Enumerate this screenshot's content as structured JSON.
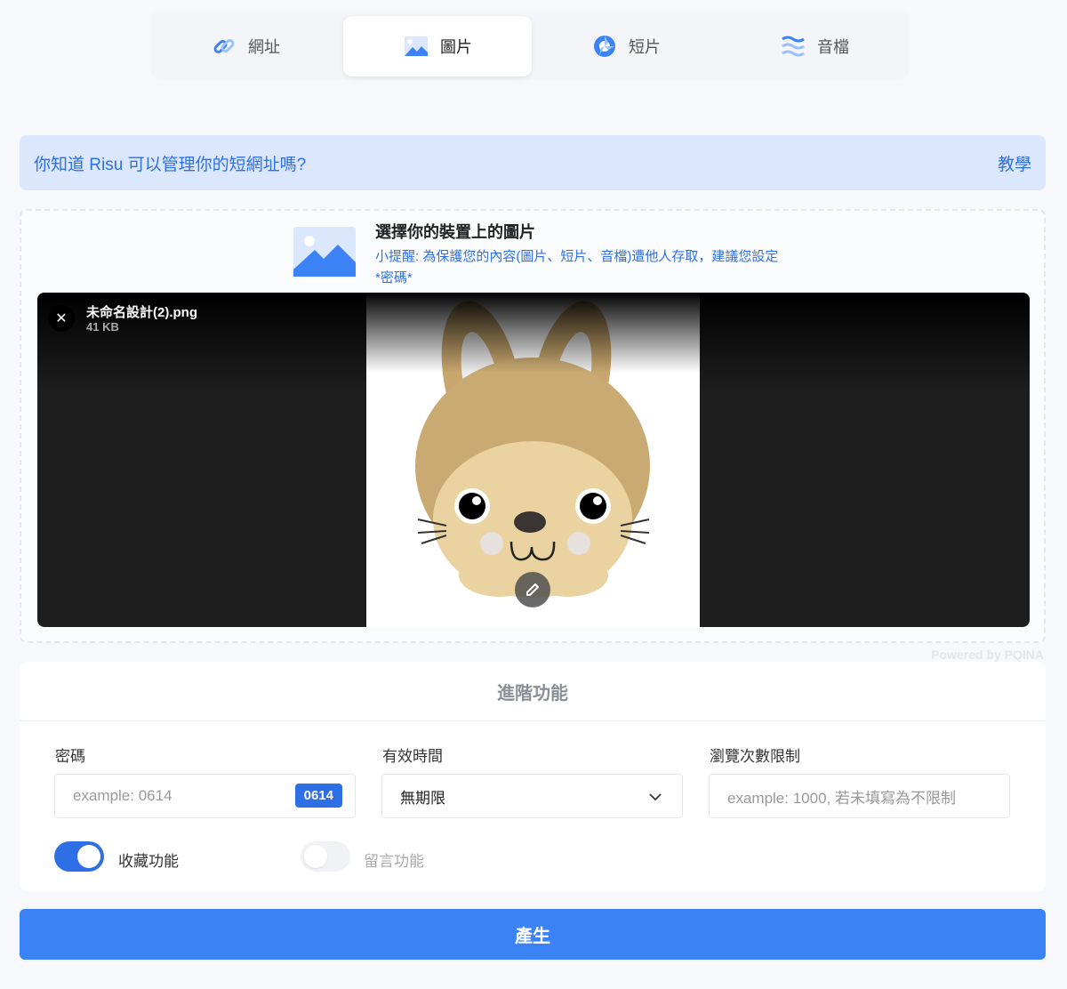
{
  "tabs": [
    {
      "label": "網址",
      "icon": "link-icon"
    },
    {
      "label": "圖片",
      "icon": "image-icon",
      "active": true
    },
    {
      "label": "短片",
      "icon": "shutter-icon"
    },
    {
      "label": "音檔",
      "icon": "wave-icon"
    }
  ],
  "notice": {
    "text": "你知道 Risu 可以管理你的短網址嗎?",
    "link": "教學"
  },
  "upload": {
    "title": "選擇你的裝置上的圖片",
    "tip": "小提醒: 為保護您的內容(圖片、短片、音檔)遭他人存取，建議您設定 *密碼*",
    "file_name": "未命名設計(2).png",
    "file_size": "41 KB",
    "powered": "Powered by PQINA"
  },
  "advanced": {
    "title": "進階功能",
    "password": {
      "label": "密碼",
      "placeholder": "example: 0614",
      "badge": "0614"
    },
    "expiry": {
      "label": "有效時間",
      "value": "無期限"
    },
    "view_limit": {
      "label": "瀏覽次數限制",
      "placeholder": "example: 1000, 若未填寫為不限制"
    },
    "favorite": {
      "label": "收藏功能",
      "on": true
    },
    "comment": {
      "label": "留言功能",
      "on": false
    }
  },
  "generate_label": "產生",
  "colors": {
    "primary": "#3b82f6",
    "notice_bg": "#dbe7fd",
    "link": "#2f6fe6"
  }
}
